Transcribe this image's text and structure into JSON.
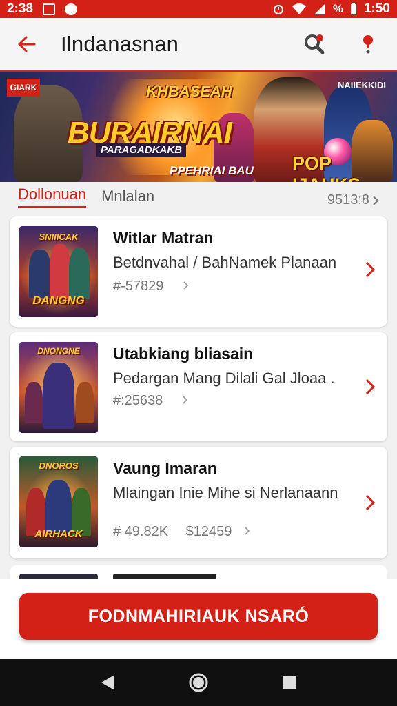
{
  "status_bar": {
    "time_left": "2:38",
    "time_right": "1:50",
    "battery_label": "%"
  },
  "app_bar": {
    "title": "Ilndanasnan"
  },
  "banner": {
    "badge": "GIARK",
    "corner_text": "NAIIEKKIDI",
    "logo_top": "KHBASEAH",
    "logo_main": "BURAIRNAI",
    "logo_sub": "PARAGADKAKB",
    "bottom_text": "PPEHRIAI BAU",
    "right_logo": "POP IJAHKS"
  },
  "tabs": {
    "items": [
      {
        "label": "Dollonuan",
        "active": true
      },
      {
        "label": "Mnlalan",
        "active": false
      }
    ],
    "count": "9513:8"
  },
  "cards": [
    {
      "title": "Witlar Matran",
      "subtitle": "Betdnvahal / BahNamek Planaan",
      "meta": "#-57829",
      "meta2": "",
      "thumb_top": "SNIIICAK",
      "thumb_bottom": "DANGNG"
    },
    {
      "title": "Utabkiang bliasain",
      "subtitle": "Pedargan Mang Dilali Gal Jloaa .",
      "meta": "#:25638",
      "meta2": "",
      "thumb_top": "DNONGNE",
      "thumb_bottom": ""
    },
    {
      "title": "Vaung Imaran",
      "subtitle": "Mlaingan Inie Mihe si Nerlanaann",
      "meta": "# 49.82K",
      "meta2": "$12459",
      "thumb_top": "DNOROS",
      "thumb_bottom": "AIRHACK"
    }
  ],
  "cta": {
    "label": "FODNMAHIRIAUK NSARÓ"
  },
  "colors": {
    "accent": "#d32117",
    "nav_bg": "#101010"
  }
}
